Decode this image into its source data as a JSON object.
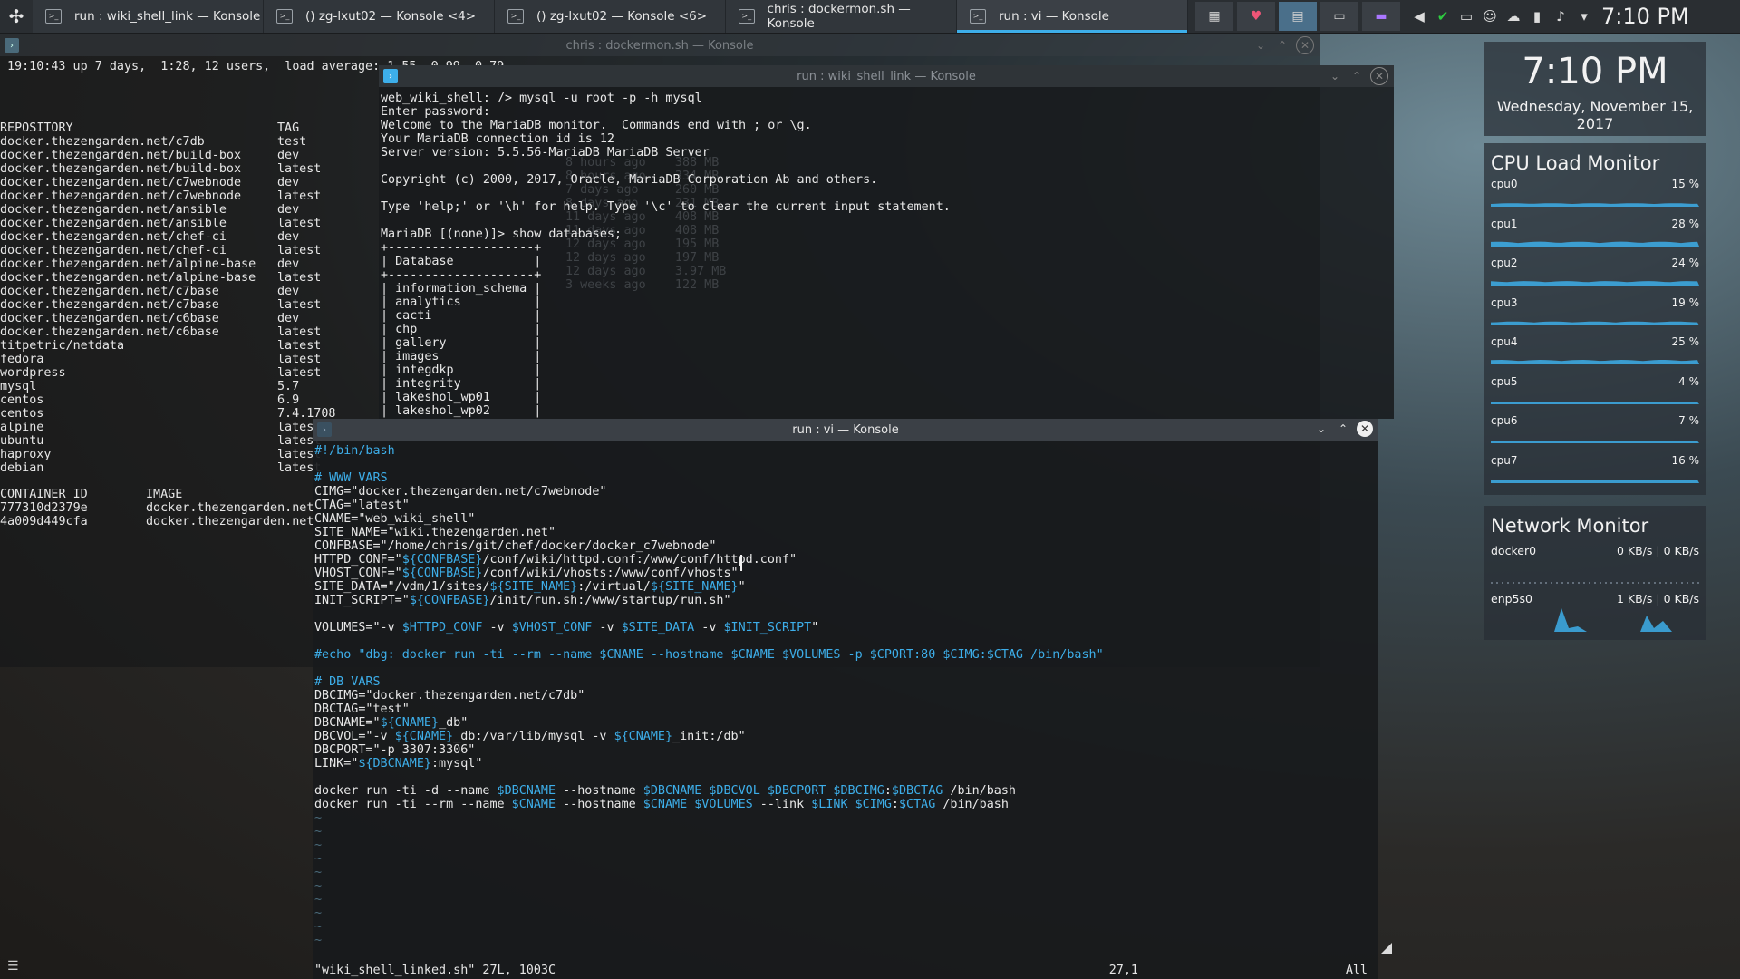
{
  "colors": {
    "accent": "#3daee9",
    "terminal_bg": "#1a1c1e",
    "widget_bg": "#2e343a"
  },
  "taskbar": {
    "launcher_icon": "kde-launcher-icon",
    "tasks": [
      {
        "label": "run : wiki_shell_link — Konsole",
        "icon": "terminal-icon"
      },
      {
        "label": "() zg-lxut02 — Konsole <4>",
        "icon": "terminal-icon"
      },
      {
        "label": "() zg-lxut02 — Konsole <6>",
        "icon": "terminal-icon"
      },
      {
        "label": "chris : dockermon.sh — Konsole",
        "icon": "terminal-icon"
      },
      {
        "label": "run : vi — Konsole",
        "icon": "terminal-icon"
      }
    ],
    "tray_icons": [
      "notifications-icon",
      "update-ok-icon",
      "display-icon",
      "user-icon",
      "network-icon",
      "battery-icon",
      "volume-icon",
      "expand-arrow-icon"
    ],
    "clock": "7:10 PM"
  },
  "docker_window": {
    "title": "chris : dockermon.sh — Konsole",
    "uptime": "19:10:43 up 7 days,  1:28, 12 users,  load average: 1.55, 0.99, 0.79",
    "images_header": [
      "REPOSITORY",
      "TAG"
    ],
    "images": [
      [
        "docker.thezengarden.net/c7db",
        "test"
      ],
      [
        "docker.thezengarden.net/build-box",
        "dev"
      ],
      [
        "docker.thezengarden.net/build-box",
        "latest"
      ],
      [
        "docker.thezengarden.net/c7webnode",
        "dev"
      ],
      [
        "docker.thezengarden.net/c7webnode",
        "latest"
      ],
      [
        "docker.thezengarden.net/ansible",
        "dev"
      ],
      [
        "docker.thezengarden.net/ansible",
        "latest"
      ],
      [
        "docker.thezengarden.net/chef-ci",
        "dev"
      ],
      [
        "docker.thezengarden.net/chef-ci",
        "latest"
      ],
      [
        "docker.thezengarden.net/alpine-base",
        "dev"
      ],
      [
        "docker.thezengarden.net/alpine-base",
        "latest"
      ],
      [
        "docker.thezengarden.net/c7base",
        "dev"
      ],
      [
        "docker.thezengarden.net/c7base",
        "latest"
      ],
      [
        "docker.thezengarden.net/c6base",
        "dev"
      ],
      [
        "docker.thezengarden.net/c6base",
        "latest"
      ],
      [
        "titpetric/netdata",
        "latest"
      ],
      [
        "fedora",
        "latest"
      ],
      [
        "wordpress",
        "latest"
      ],
      [
        "mysql",
        "5.7"
      ],
      [
        "centos",
        "6.9"
      ],
      [
        "centos",
        "7.4.1708"
      ],
      [
        "alpine",
        "latest"
      ],
      [
        "ubuntu",
        "latest"
      ],
      [
        "haproxy",
        "latest"
      ],
      [
        "debian",
        "latest"
      ]
    ],
    "containers_header": [
      "CONTAINER ID",
      "IMAGE"
    ],
    "containers": [
      [
        "777310d2379e",
        "docker.thezengarden.net"
      ],
      [
        "4a009d449cfa",
        "docker.thezengarden.net"
      ]
    ]
  },
  "mysql_window": {
    "title": "run : wiki_shell_link — Konsole",
    "lines": [
      "web_wiki_shell: /> mysql -u root -p -h mysql",
      "Enter password:",
      "Welcome to the MariaDB monitor.  Commands end with ; or \\g.",
      "Your MariaDB connection id is 12",
      "Server version: 5.5.56-MariaDB MariaDB Server",
      "",
      "Copyright (c) 2000, 2017, Oracle, MariaDB Corporation Ab and others.",
      "",
      "Type 'help;' or '\\h' for help. Type '\\c' to clear the current input statement.",
      "",
      "MariaDB [(none)]> show databases;",
      "+--------------------+",
      "| Database           |",
      "+--------------------+",
      "| information_schema |",
      "| analytics          |",
      "| cacti              |",
      "| chp                |",
      "| gallery            |",
      "| images             |",
      "| integdkp           |",
      "| integrity          |",
      "| lakeshol_wp01      |",
      "| lakeshol_wp02      |"
    ],
    "ghost_lines": [
      "8 hours ago    388 MB",
      "8 hours ago    334 MB",
      "7 days ago     260 MB",
      "8 days ago     231 MB",
      "11 days ago    408 MB",
      "11 days ago    408 MB",
      "12 days ago    195 MB",
      "12 days ago    197 MB",
      "12 days ago    3.97 MB",
      "3 weeks ago    122 MB"
    ]
  },
  "vi_window": {
    "title": "run : vi — Konsole",
    "lines": [
      "#!/bin/bash",
      "",
      "# WWW VARS",
      "CIMG=\"docker.thezengarden.net/c7webnode\"",
      "CTAG=\"latest\"",
      "CNAME=\"web_wiki_shell\"",
      "SITE_NAME=\"wiki.thezengarden.net\"",
      "CONFBASE=\"/home/chris/git/chef/docker/docker_c7webnode\"",
      "HTTPD_CONF=\"${CONFBASE}/conf/wiki/httpd.conf:/www/conf/httpd.conf\"",
      "VHOST_CONF=\"${CONFBASE}/conf/wiki/vhosts:/www/conf/vhosts\"",
      "SITE_DATA=\"/vdm/1/sites/${SITE_NAME}:/virtual/${SITE_NAME}\"",
      "INIT_SCRIPT=\"${CONFBASE}/init/run.sh:/www/startup/run.sh\"",
      "",
      "VOLUMES=\"-v $HTTPD_CONF -v $VHOST_CONF -v $SITE_DATA -v $INIT_SCRIPT\"",
      "",
      "#echo \"dbg: docker run -ti --rm --name $CNAME --hostname $CNAME $VOLUMES -p $CPORT:80 $CIMG:$CTAG /bin/bash\"",
      "",
      "# DB VARS",
      "DBCIMG=\"docker.thezengarden.net/c7db\"",
      "DBCTAG=\"test\"",
      "DBCNAME=\"${CNAME}_db\"",
      "DBCVOL=\"-v ${CNAME}_db:/var/lib/mysql -v ${CNAME}_init:/db\"",
      "DBCPORT=\"-p 3307:3306\"",
      "LINK=\"${DBCNAME}:mysql\"",
      "",
      "docker run -ti -d --name $DBCNAME --hostname $DBCNAME $DBCVOL $DBCPORT $DBCIMG:$DBCTAG /bin/bash",
      "docker run -ti --rm --name $CNAME --hostname $CNAME $VOLUMES --link $LINK $CIMG:$CTAG /bin/bash",
      "~",
      "~",
      "~",
      "~",
      "~",
      "~",
      "~",
      "~",
      "~",
      "~"
    ],
    "status_file": "\"wiki_shell_linked.sh\" 27L, 1003C",
    "status_pos": "27,1",
    "status_all": "All"
  },
  "clock_widget": {
    "time": "7:10 PM",
    "date": "Wednesday, November 15, 2017"
  },
  "cpu_widget": {
    "title": "CPU Load Monitor",
    "cpus": [
      {
        "name": "cpu0",
        "value": "15 %",
        "load": 15
      },
      {
        "name": "cpu1",
        "value": "28 %",
        "load": 28
      },
      {
        "name": "cpu2",
        "value": "24 %",
        "load": 24
      },
      {
        "name": "cpu3",
        "value": "19 %",
        "load": 19
      },
      {
        "name": "cpu4",
        "value": "25 %",
        "load": 25
      },
      {
        "name": "cpu5",
        "value": "4 %",
        "load": 4
      },
      {
        "name": "cpu6",
        "value": "7 %",
        "load": 7
      },
      {
        "name": "cpu7",
        "value": "16 %",
        "load": 16
      }
    ]
  },
  "network_widget": {
    "title": "Network Monitor",
    "interfaces": [
      {
        "name": "docker0",
        "value": "0 KB/s | 0 KB/s"
      },
      {
        "name": "enp5s0",
        "value": "1 KB/s | 0 KB/s"
      }
    ]
  }
}
